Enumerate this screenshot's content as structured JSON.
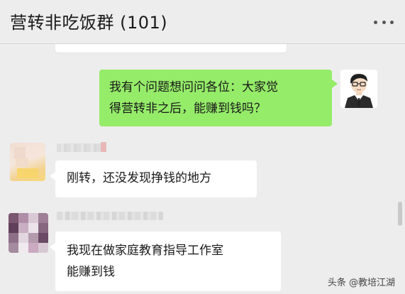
{
  "header": {
    "title": "营转非吃饭群 (101)",
    "more_icon": "more-dots-icon"
  },
  "messages": [
    {
      "sender": "self",
      "lines": [
        "我有个问题想问问各位：大家觉",
        "得营转非之后，能赚到钱吗？"
      ],
      "bubble_color": "#95ec69"
    },
    {
      "sender": "member",
      "lines": [
        "刚转，还没发现挣钱的地方"
      ],
      "bubble_color": "#ffffff"
    },
    {
      "sender": "member",
      "lines": [
        "我现在做家庭教育指导工作室",
        "能赚到钱"
      ],
      "bubble_color": "#ffffff"
    }
  ],
  "watermark": "头条 @教培江湖",
  "colors": {
    "background": "#ededed",
    "self_bubble": "#95ec69",
    "other_bubble": "#ffffff"
  }
}
